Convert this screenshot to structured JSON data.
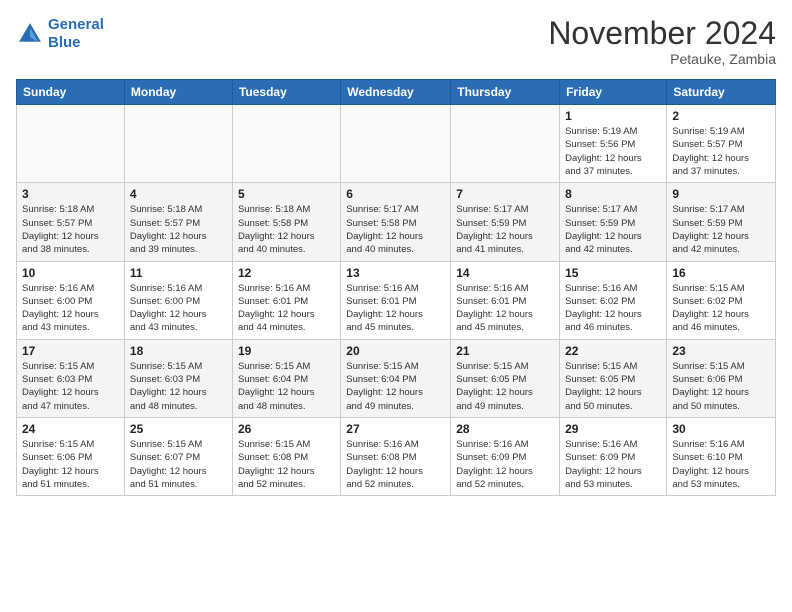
{
  "header": {
    "logo_line1": "General",
    "logo_line2": "Blue",
    "month": "November 2024",
    "location": "Petauke, Zambia"
  },
  "weekdays": [
    "Sunday",
    "Monday",
    "Tuesday",
    "Wednesday",
    "Thursday",
    "Friday",
    "Saturday"
  ],
  "weeks": [
    [
      {
        "day": "",
        "info": ""
      },
      {
        "day": "",
        "info": ""
      },
      {
        "day": "",
        "info": ""
      },
      {
        "day": "",
        "info": ""
      },
      {
        "day": "",
        "info": ""
      },
      {
        "day": "1",
        "info": "Sunrise: 5:19 AM\nSunset: 5:56 PM\nDaylight: 12 hours\nand 37 minutes."
      },
      {
        "day": "2",
        "info": "Sunrise: 5:19 AM\nSunset: 5:57 PM\nDaylight: 12 hours\nand 37 minutes."
      }
    ],
    [
      {
        "day": "3",
        "info": "Sunrise: 5:18 AM\nSunset: 5:57 PM\nDaylight: 12 hours\nand 38 minutes."
      },
      {
        "day": "4",
        "info": "Sunrise: 5:18 AM\nSunset: 5:57 PM\nDaylight: 12 hours\nand 39 minutes."
      },
      {
        "day": "5",
        "info": "Sunrise: 5:18 AM\nSunset: 5:58 PM\nDaylight: 12 hours\nand 40 minutes."
      },
      {
        "day": "6",
        "info": "Sunrise: 5:17 AM\nSunset: 5:58 PM\nDaylight: 12 hours\nand 40 minutes."
      },
      {
        "day": "7",
        "info": "Sunrise: 5:17 AM\nSunset: 5:59 PM\nDaylight: 12 hours\nand 41 minutes."
      },
      {
        "day": "8",
        "info": "Sunrise: 5:17 AM\nSunset: 5:59 PM\nDaylight: 12 hours\nand 42 minutes."
      },
      {
        "day": "9",
        "info": "Sunrise: 5:17 AM\nSunset: 5:59 PM\nDaylight: 12 hours\nand 42 minutes."
      }
    ],
    [
      {
        "day": "10",
        "info": "Sunrise: 5:16 AM\nSunset: 6:00 PM\nDaylight: 12 hours\nand 43 minutes."
      },
      {
        "day": "11",
        "info": "Sunrise: 5:16 AM\nSunset: 6:00 PM\nDaylight: 12 hours\nand 43 minutes."
      },
      {
        "day": "12",
        "info": "Sunrise: 5:16 AM\nSunset: 6:01 PM\nDaylight: 12 hours\nand 44 minutes."
      },
      {
        "day": "13",
        "info": "Sunrise: 5:16 AM\nSunset: 6:01 PM\nDaylight: 12 hours\nand 45 minutes."
      },
      {
        "day": "14",
        "info": "Sunrise: 5:16 AM\nSunset: 6:01 PM\nDaylight: 12 hours\nand 45 minutes."
      },
      {
        "day": "15",
        "info": "Sunrise: 5:16 AM\nSunset: 6:02 PM\nDaylight: 12 hours\nand 46 minutes."
      },
      {
        "day": "16",
        "info": "Sunrise: 5:15 AM\nSunset: 6:02 PM\nDaylight: 12 hours\nand 46 minutes."
      }
    ],
    [
      {
        "day": "17",
        "info": "Sunrise: 5:15 AM\nSunset: 6:03 PM\nDaylight: 12 hours\nand 47 minutes."
      },
      {
        "day": "18",
        "info": "Sunrise: 5:15 AM\nSunset: 6:03 PM\nDaylight: 12 hours\nand 48 minutes."
      },
      {
        "day": "19",
        "info": "Sunrise: 5:15 AM\nSunset: 6:04 PM\nDaylight: 12 hours\nand 48 minutes."
      },
      {
        "day": "20",
        "info": "Sunrise: 5:15 AM\nSunset: 6:04 PM\nDaylight: 12 hours\nand 49 minutes."
      },
      {
        "day": "21",
        "info": "Sunrise: 5:15 AM\nSunset: 6:05 PM\nDaylight: 12 hours\nand 49 minutes."
      },
      {
        "day": "22",
        "info": "Sunrise: 5:15 AM\nSunset: 6:05 PM\nDaylight: 12 hours\nand 50 minutes."
      },
      {
        "day": "23",
        "info": "Sunrise: 5:15 AM\nSunset: 6:06 PM\nDaylight: 12 hours\nand 50 minutes."
      }
    ],
    [
      {
        "day": "24",
        "info": "Sunrise: 5:15 AM\nSunset: 6:06 PM\nDaylight: 12 hours\nand 51 minutes."
      },
      {
        "day": "25",
        "info": "Sunrise: 5:15 AM\nSunset: 6:07 PM\nDaylight: 12 hours\nand 51 minutes."
      },
      {
        "day": "26",
        "info": "Sunrise: 5:15 AM\nSunset: 6:08 PM\nDaylight: 12 hours\nand 52 minutes."
      },
      {
        "day": "27",
        "info": "Sunrise: 5:16 AM\nSunset: 6:08 PM\nDaylight: 12 hours\nand 52 minutes."
      },
      {
        "day": "28",
        "info": "Sunrise: 5:16 AM\nSunset: 6:09 PM\nDaylight: 12 hours\nand 52 minutes."
      },
      {
        "day": "29",
        "info": "Sunrise: 5:16 AM\nSunset: 6:09 PM\nDaylight: 12 hours\nand 53 minutes."
      },
      {
        "day": "30",
        "info": "Sunrise: 5:16 AM\nSunset: 6:10 PM\nDaylight: 12 hours\nand 53 minutes."
      }
    ]
  ]
}
